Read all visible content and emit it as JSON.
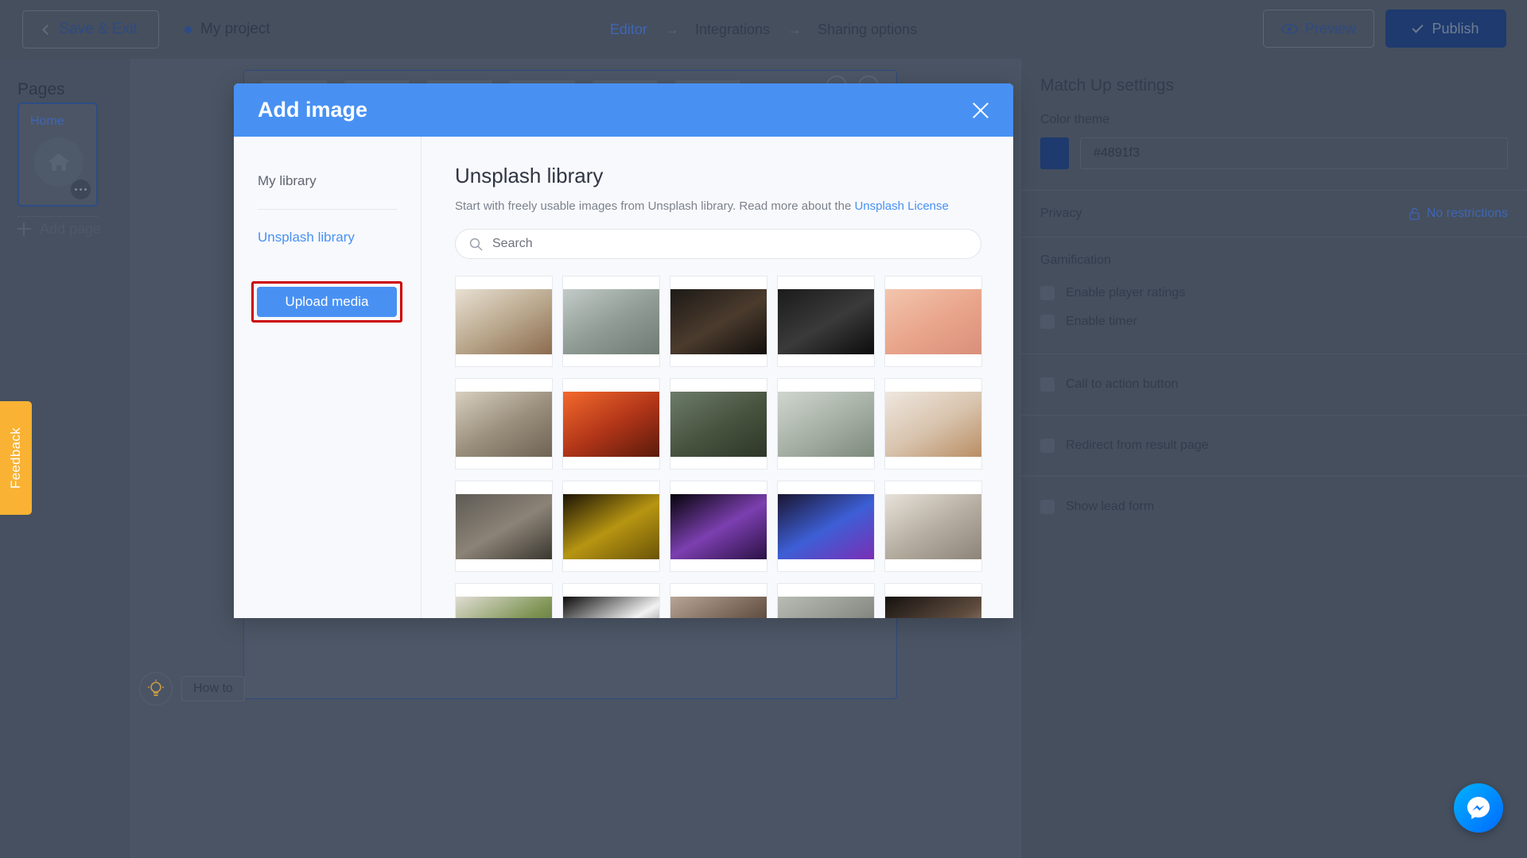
{
  "topbar": {
    "save_exit": "Save & Exit",
    "project_name": "My project",
    "breadcrumbs": [
      {
        "label": "Editor",
        "active": true
      },
      {
        "label": "Integrations",
        "active": false
      },
      {
        "label": "Sharing options",
        "active": false
      }
    ],
    "arrow": "→",
    "preview": "Preview",
    "publish": "Publish"
  },
  "pages": {
    "title": "Pages",
    "page_label": "Home",
    "add_page": "Add page"
  },
  "feedback": {
    "label": "Feedback"
  },
  "howto": {
    "label": "How to"
  },
  "modal": {
    "title": "Add image",
    "nav": {
      "my_library": "My library",
      "unsplash_library": "Unsplash library",
      "upload_media": "Upload media"
    },
    "main": {
      "title": "Unsplash library",
      "description_before": "Start with freely usable images from Unsplash library. Read more about the ",
      "license_link": "Unsplash License",
      "search_placeholder": "Search"
    }
  },
  "settings": {
    "title": "Match Up settings",
    "color_theme_label": "Color theme",
    "color_theme_value": "#4891f3",
    "color_swatch": "#1e3a6e",
    "privacy_label": "Privacy",
    "privacy_value": "No restrictions",
    "gamification_label": "Gamification",
    "enable_player_ratings": "Enable player ratings",
    "enable_timer": "Enable timer",
    "call_to_action": "Call to action button",
    "redirect_result": "Redirect from result page",
    "show_lead_form": "Show lead form"
  },
  "accent": {
    "blue": "#4891f3",
    "highlight_red": "#cc0000",
    "yellow": "#f9b233"
  },
  "image_grid": [
    {
      "name": "flatlay-food-prep",
      "c1": "#e8e0d3",
      "c2": "#b9a78c",
      "c3": "#8c6b4f"
    },
    {
      "name": "coastal-cliff-road",
      "c1": "#c3cbc8",
      "c2": "#8f9b94",
      "c3": "#6e7a72"
    },
    {
      "name": "dark-window-curtain",
      "c1": "#1d1a17",
      "c2": "#4b3b2d",
      "c3": "#120f0d"
    },
    {
      "name": "vintage-camera",
      "c1": "#1b1b1b",
      "c2": "#3a3a3a",
      "c3": "#0c0c0c"
    },
    {
      "name": "pastel-abstract-hand",
      "c1": "#f2c6ad",
      "c2": "#e9a58c",
      "c3": "#d98f7a"
    },
    {
      "name": "people-at-table",
      "c1": "#d8cfc0",
      "c2": "#9a8f7c",
      "c3": "#6f6354"
    },
    {
      "name": "orange-sphere-car",
      "c1": "#f36a2d",
      "c2": "#b13518",
      "c3": "#5a1a0c"
    },
    {
      "name": "mountain-hairpin-road",
      "c1": "#6c7b6a",
      "c2": "#48543f",
      "c3": "#2e3628"
    },
    {
      "name": "pastel-building-facade",
      "c1": "#cfd6cf",
      "c2": "#a7b0a5",
      "c3": "#7d8a7c"
    },
    {
      "name": "pancake-plate",
      "c1": "#efe7df",
      "c2": "#d8c3ad",
      "c3": "#b98e63"
    },
    {
      "name": "picnic-blanket-feast",
      "c1": "#5d5a54",
      "c2": "#8c8377",
      "c3": "#3a372f"
    },
    {
      "name": "yellow-autumn-tree",
      "c1": "#1b1405",
      "c2": "#b79512",
      "c3": "#6a5307"
    },
    {
      "name": "purple-fractal-light",
      "c1": "#05040a",
      "c2": "#7c3fb0",
      "c3": "#2b1145"
    },
    {
      "name": "blue-neon-portrait",
      "c1": "#1a1530",
      "c2": "#3d5fd6",
      "c3": "#7a2fb5"
    },
    {
      "name": "keyboard-keycaps",
      "c1": "#e7e2da",
      "c2": "#b5ada0",
      "c3": "#8c8478"
    },
    {
      "name": "green-salad-bowl",
      "c1": "#e0ddd4",
      "c2": "#7d9352",
      "c3": "#4a5a31"
    },
    {
      "name": "black-white-minimal",
      "c1": "#0b0b0b",
      "c2": "#f2f2f2",
      "c3": "#2a2a2a"
    },
    {
      "name": "hands-dark-scene",
      "c1": "#b7a596",
      "c2": "#6f5c4e",
      "c3": "#2b2320"
    },
    {
      "name": "apartment-block",
      "c1": "#b9bcb4",
      "c2": "#8d9189",
      "c3": "#5d6159"
    },
    {
      "name": "portrait-woman-dark",
      "c1": "#15120f",
      "c2": "#5e4b3e",
      "c3": "#cbb7a4"
    }
  ]
}
